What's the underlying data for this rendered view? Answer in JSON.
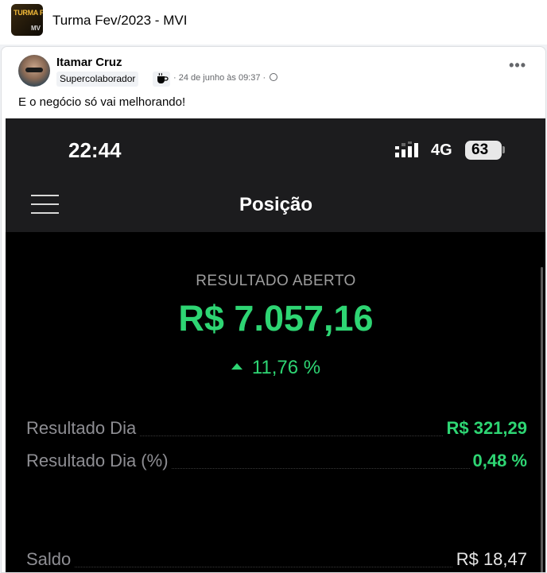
{
  "group": {
    "name": "Turma Fev/2023 - MVI",
    "thumb_text_top": "TURMA FEV",
    "thumb_text_bottom": "MV"
  },
  "post": {
    "author": "Itamar Cruz",
    "badge": "Supercolaborador",
    "badge_icon": "coffee-icon",
    "timestamp": "· 24 de junho às 09:37 ·",
    "privacy_icon": "globe-icon",
    "more_icon": "more-options-icon",
    "text": "E o negócio só vai melhorando!"
  },
  "screenshot": {
    "status_bar": {
      "time": "22:44",
      "network": "4G",
      "battery": "63"
    },
    "app_title": "Posição",
    "result_label": "RESULTADO ABERTO",
    "result_value": "R$ 7.057,16",
    "result_percent": "11,76 %",
    "rows": [
      {
        "label": "Resultado Dia",
        "value": "R$ 321,29"
      },
      {
        "label": "Resultado Dia (%)",
        "value": "0,48 %"
      },
      {
        "label": "Saldo",
        "value": "R$ 18,47"
      }
    ],
    "colors": {
      "positive": "#2ed573",
      "background": "#000000",
      "header": "#1c1c1e"
    }
  }
}
